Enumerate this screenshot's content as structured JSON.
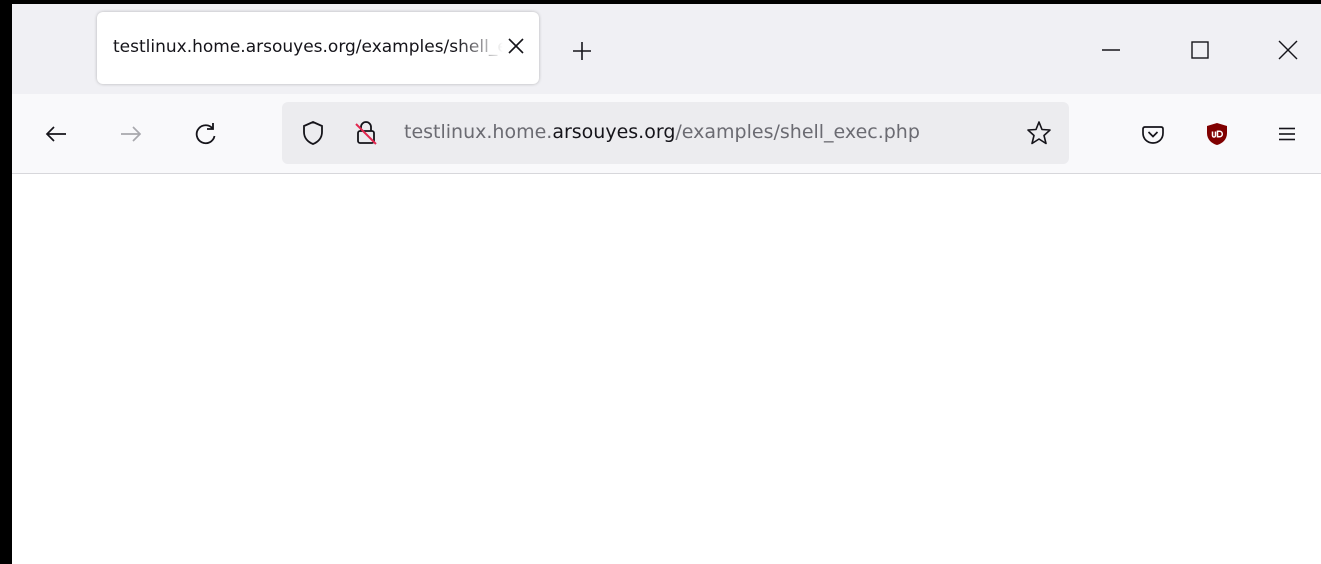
{
  "browser": {
    "tab": {
      "title": "testlinux.home.arsouyes.org/examples/shell_exec.php",
      "close_icon": "close-icon"
    },
    "new_tab_icon": "plus-icon",
    "window_controls": {
      "minimize_icon": "minimize-icon",
      "maximize_icon": "maximize-icon",
      "close_icon": "close-icon"
    },
    "nav": {
      "back_icon": "arrow-left-icon",
      "forward_icon": "arrow-right-icon",
      "reload_icon": "reload-icon"
    },
    "urlbar": {
      "tracking_icon": "shield-icon",
      "security_icon": "insecure-lock-icon",
      "url_prefix": "testlinux.home.",
      "url_domain": "arsouyes.org",
      "url_path": "/examples/shell_exec.php",
      "bookmark_icon": "star-icon"
    },
    "toolbar": {
      "pocket_icon": "pocket-icon",
      "extension_icon": "ublock-icon",
      "menu_icon": "hamburger-menu-icon"
    }
  },
  "colors": {
    "chrome_bg": "#f0f0f4",
    "navbar_bg": "#f9f9fb",
    "urlbar_bg": "#ececef",
    "text": "#15141a",
    "muted_text": "#6b6b72",
    "ublock_red": "#800000"
  }
}
